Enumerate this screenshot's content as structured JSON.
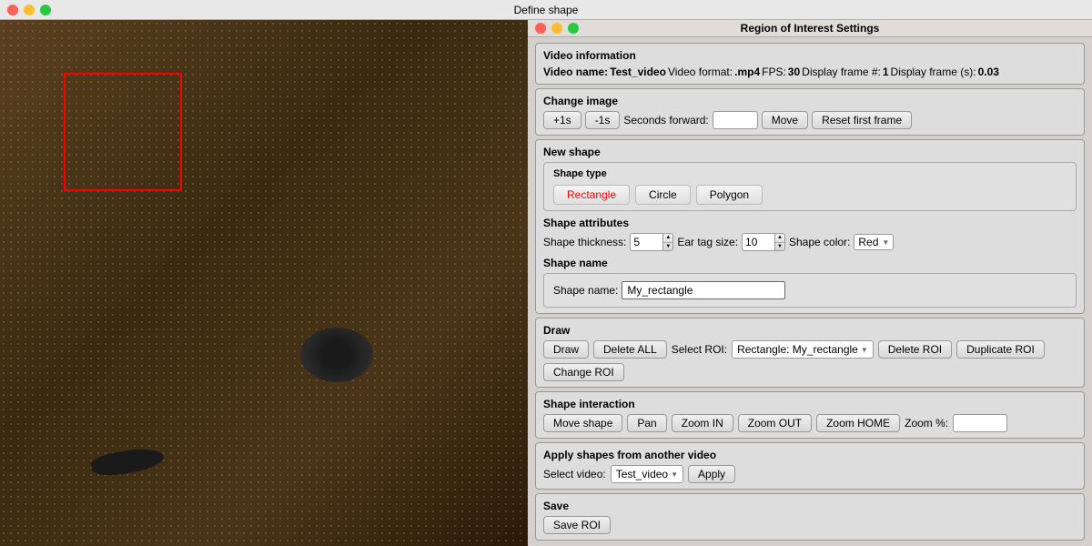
{
  "window": {
    "left_title": "Define shape",
    "right_title": "Region of Interest Settings"
  },
  "video_info": {
    "label": "Video information",
    "name_label": "Video name:",
    "name_value": "Test_video",
    "format_label": "Video format:",
    "format_value": ".mp4",
    "fps_label": "FPS:",
    "fps_value": "30",
    "display_frame_label": "Display frame #:",
    "display_frame_value": "1",
    "display_frame_s_label": "Display frame (s):",
    "display_frame_s_value": "0.03"
  },
  "change_image": {
    "label": "Change image",
    "btn_plus1s": "+1s",
    "btn_minus1s": "-1s",
    "seconds_forward_label": "Seconds forward:",
    "seconds_forward_value": "",
    "btn_move": "Move",
    "btn_reset": "Reset first frame"
  },
  "new_shape": {
    "label": "New shape",
    "shape_type": {
      "legend": "Shape type",
      "rectangle": "Rectangle",
      "circle": "Circle",
      "polygon": "Polygon"
    },
    "shape_attributes": {
      "label": "Shape attributes",
      "thickness_label": "Shape thickness:",
      "thickness_value": "5",
      "ear_tag_label": "Ear tag size:",
      "ear_tag_value": "10",
      "color_label": "Shape color:",
      "color_value": "Red"
    },
    "shape_name": {
      "label": "Shape name",
      "name_label": "Shape name:",
      "name_value": "My_rectangle"
    }
  },
  "draw": {
    "label": "Draw",
    "btn_draw": "Draw",
    "btn_delete_all": "Delete ALL",
    "select_roi_label": "Select ROI:",
    "select_roi_value": "Rectangle: My_rectangle",
    "btn_delete_roi": "Delete ROI",
    "btn_duplicate_roi": "Duplicate ROI",
    "btn_change_roi": "Change ROI"
  },
  "shape_interaction": {
    "label": "Shape interaction",
    "btn_move_shape": "Move shape",
    "btn_pan": "Pan",
    "btn_zoom_in": "Zoom IN",
    "btn_zoom_out": "Zoom OUT",
    "btn_zoom_home": "Zoom HOME",
    "zoom_pct_label": "Zoom %:"
  },
  "apply_shapes": {
    "label": "Apply shapes from another video",
    "select_video_label": "Select video:",
    "select_video_value": "Test_video",
    "btn_apply": "Apply"
  },
  "save": {
    "label": "Save",
    "btn_save_roi": "Save ROI"
  }
}
